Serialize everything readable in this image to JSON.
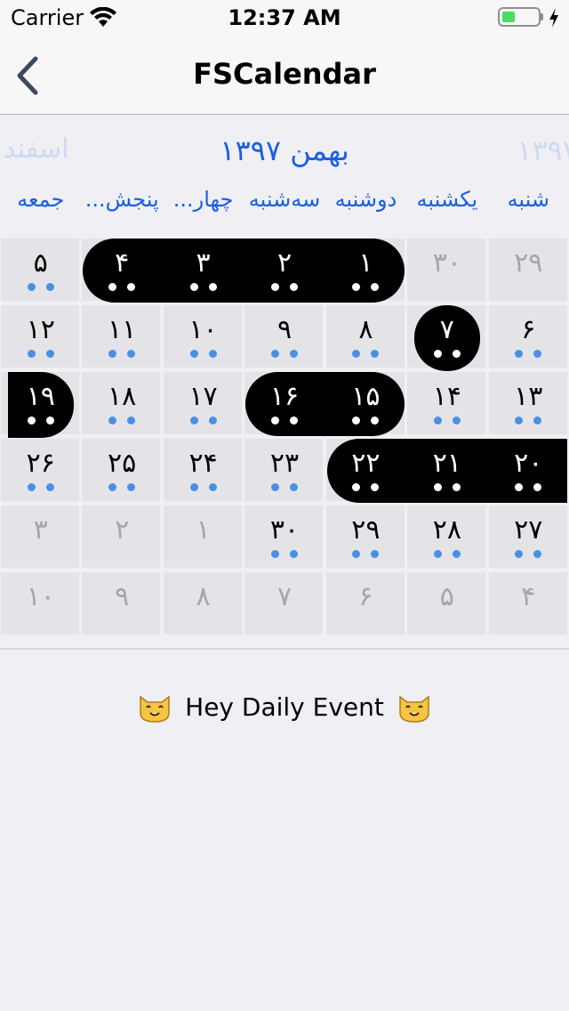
{
  "status_bar": {
    "carrier": "Carrier",
    "time": "12:37 AM"
  },
  "nav": {
    "title": "FSCalendar"
  },
  "calendar": {
    "header": {
      "current": "بهمن ۱۳۹۷",
      "previous_partial": "اسفند",
      "next_partial": "۱۳۹۷"
    },
    "weekdays": [
      "شنبه",
      "یکشنبه",
      "دوشنبه",
      "سه‌شنبه",
      "چهار...",
      "پنجش...",
      "جمعه"
    ],
    "weeks": [
      [
        "۲۹",
        "۳۰",
        "۱",
        "۲",
        "۳",
        "۴",
        "۵"
      ],
      [
        "۶",
        "۷",
        "۸",
        "۹",
        "۱۰",
        "۱۱",
        "۱۲"
      ],
      [
        "۱۳",
        "۱۴",
        "۱۵",
        "۱۶",
        "۱۷",
        "۱۸",
        "۱۹"
      ],
      [
        "۲۰",
        "۲۱",
        "۲۲",
        "۲۳",
        "۲۴",
        "۲۵",
        "۲۶"
      ],
      [
        "۲۷",
        "۲۸",
        "۲۹",
        "۳۰",
        "۱",
        "۲",
        "۳"
      ],
      [
        "۴",
        "۵",
        "۶",
        "۷",
        "۸",
        "۹",
        "۱۰"
      ]
    ],
    "in_month": [
      [
        false,
        false,
        true,
        true,
        true,
        true,
        true
      ],
      [
        true,
        true,
        true,
        true,
        true,
        true,
        true
      ],
      [
        true,
        true,
        true,
        true,
        true,
        true,
        true
      ],
      [
        true,
        true,
        true,
        true,
        true,
        true,
        true
      ],
      [
        true,
        true,
        true,
        true,
        false,
        false,
        false
      ],
      [
        false,
        false,
        false,
        false,
        false,
        false,
        false
      ]
    ],
    "selected": [
      [
        false,
        false,
        true,
        true,
        true,
        true,
        false
      ],
      [
        false,
        true,
        false,
        false,
        false,
        false,
        false
      ],
      [
        false,
        false,
        true,
        true,
        false,
        false,
        true
      ],
      [
        true,
        true,
        true,
        false,
        false,
        false,
        false
      ],
      [
        false,
        false,
        false,
        false,
        false,
        false,
        false
      ],
      [
        false,
        false,
        false,
        false,
        false,
        false,
        false
      ]
    ],
    "accent_color": "#1a5fe0",
    "event_dot_color": "#4a90e2"
  },
  "event": {
    "label": "Hey Daily Event",
    "icon": "cat-face-icon"
  }
}
